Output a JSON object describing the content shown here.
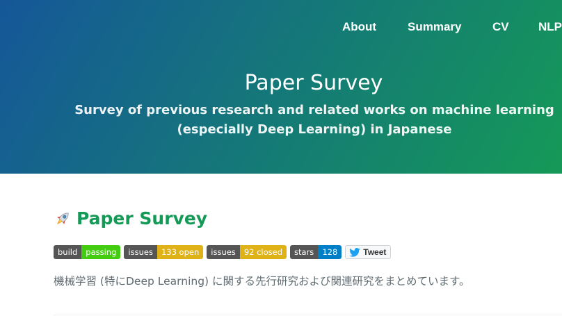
{
  "nav": {
    "items": [
      {
        "label": "About"
      },
      {
        "label": "Summary"
      },
      {
        "label": "CV"
      },
      {
        "label": "NLP"
      }
    ]
  },
  "header": {
    "title": "Paper Survey",
    "tagline": "Survey of previous research and related works on machine learning (especially Deep Learning) in Japanese"
  },
  "main": {
    "heading": "Paper Survey",
    "heading_icon": "rocket-icon",
    "badges": [
      {
        "label": "build",
        "value": "passing",
        "color": "#4c1"
      },
      {
        "label": "issues",
        "value": "133 open",
        "color": "#dfb317"
      },
      {
        "label": "issues",
        "value": "92 closed",
        "color": "#dfb317"
      },
      {
        "label": "stars",
        "value": "128",
        "color": "#007ec6"
      }
    ],
    "tweet_label": "Tweet",
    "description": "機械学習 (特にDeep Learning) に関する先行研究および関連研究をまとめています。"
  },
  "colors": {
    "gradient_start": "#155799",
    "gradient_end": "#159957",
    "heading": "#159957",
    "body_text": "#606c71"
  }
}
